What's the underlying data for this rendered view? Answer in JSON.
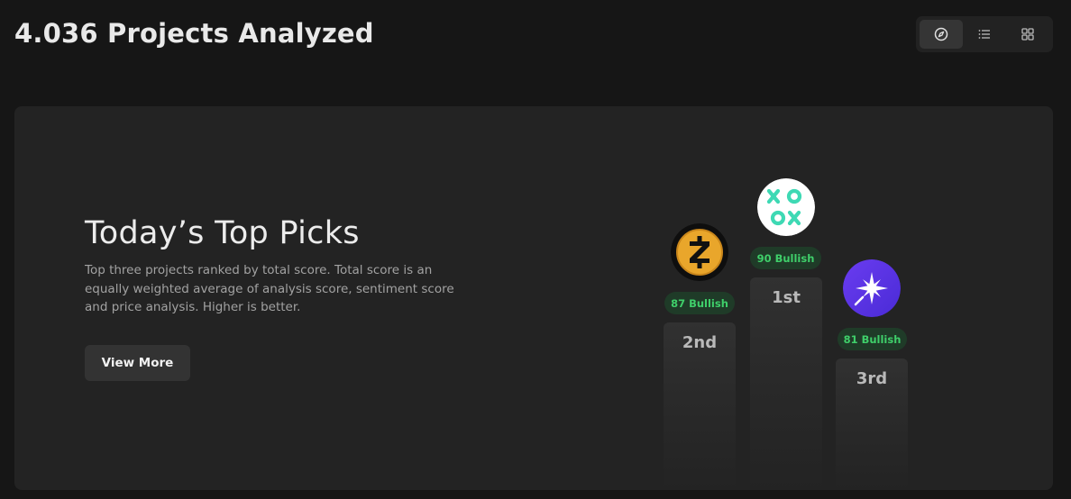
{
  "header": {
    "title": "4.036 Projects Analyzed"
  },
  "view_toggle": {
    "options": [
      {
        "icon": "compass-icon",
        "active": true
      },
      {
        "icon": "list-icon",
        "active": false
      },
      {
        "icon": "grid-icon",
        "active": false
      }
    ]
  },
  "hero": {
    "title": "Today’s Top Picks",
    "description": "Top three projects ranked by total score. Total score is an equally weighted average of analysis score, sentiment score and price analysis. Higher is better.",
    "button_label": "View More"
  },
  "podium": {
    "first": {
      "rank_label": "1st",
      "badge": "90 Bullish",
      "logo": "xoox-logo"
    },
    "second": {
      "rank_label": "2nd",
      "badge": "87 Bullish",
      "logo": "zcash-logo"
    },
    "third": {
      "rank_label": "3rd",
      "badge": "81 Bullish",
      "logo": "sparkle-logo"
    }
  },
  "colors": {
    "background": "#161616",
    "card": "#232323",
    "bullish_text": "#3fcf6a",
    "bullish_bg": "#1f3b28"
  }
}
